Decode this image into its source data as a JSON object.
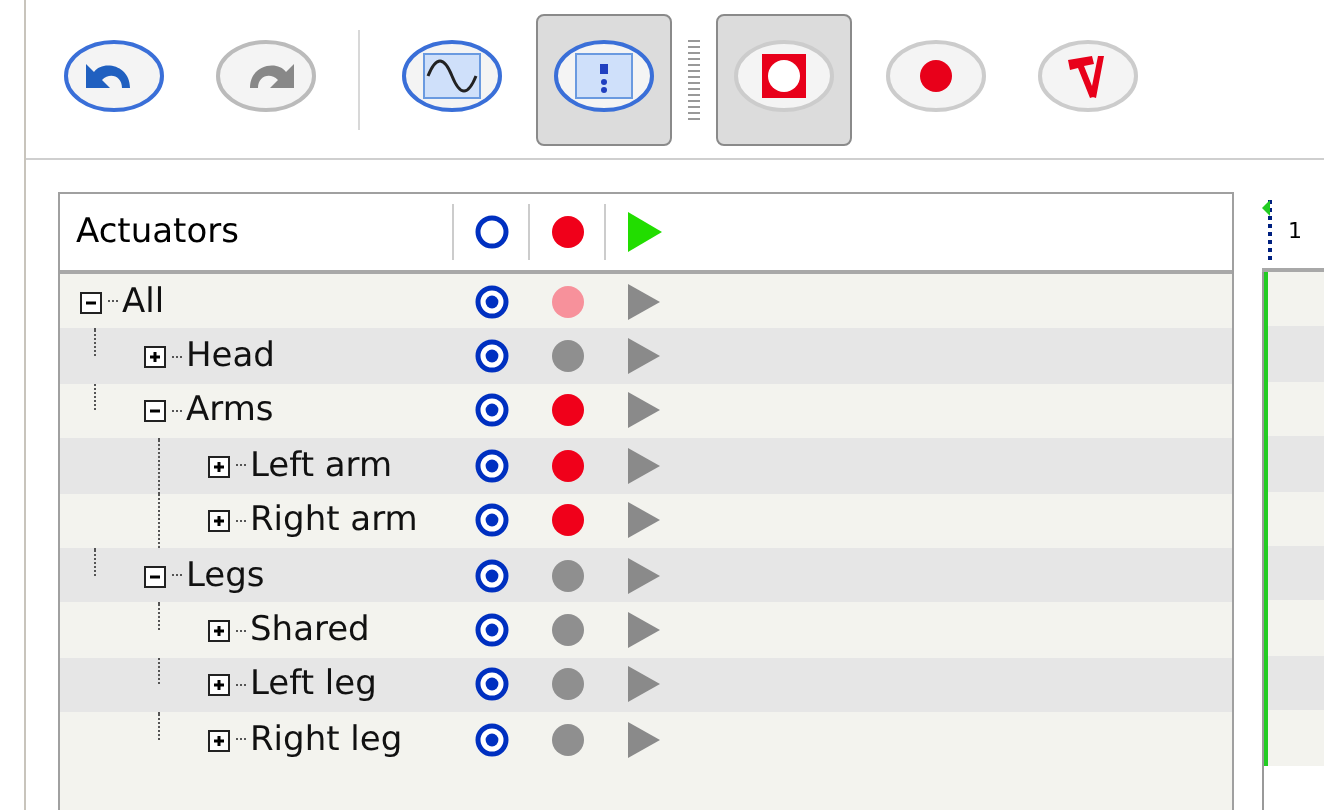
{
  "toolbar": [
    {
      "kind": "undo",
      "pressed": false,
      "disabled": false
    },
    {
      "kind": "redo",
      "pressed": false,
      "disabled": true
    },
    {
      "kind": "separator"
    },
    {
      "kind": "wave",
      "pressed": false,
      "disabled": false
    },
    {
      "kind": "script",
      "pressed": true,
      "disabled": false
    },
    {
      "kind": "grip"
    },
    {
      "kind": "stop",
      "pressed": true,
      "disabled": false
    },
    {
      "kind": "record",
      "pressed": false,
      "disabled": false
    },
    {
      "kind": "tools",
      "pressed": false,
      "disabled": false
    }
  ],
  "tree": {
    "title": "Actuators",
    "nodes": [
      {
        "label": "All",
        "expanded": true,
        "enabled": true,
        "color": "#f7919b",
        "children": [
          {
            "label": "Head",
            "expanded": false,
            "enabled": true,
            "color": "#8f8f8f"
          },
          {
            "label": "Arms",
            "expanded": true,
            "enabled": true,
            "color": "#f0001a",
            "children": [
              {
                "label": "Left arm",
                "expanded": false,
                "enabled": true,
                "color": "#f0001a"
              },
              {
                "label": "Right arm",
                "expanded": false,
                "enabled": true,
                "color": "#f0001a"
              }
            ]
          },
          {
            "label": "Legs",
            "expanded": true,
            "enabled": true,
            "color": "#8f8f8f",
            "children": [
              {
                "label": "Shared",
                "expanded": false,
                "enabled": true,
                "color": "#8f8f8f"
              },
              {
                "label": "Left leg",
                "expanded": false,
                "enabled": true,
                "color": "#8f8f8f"
              },
              {
                "label": "Right leg",
                "expanded": false,
                "enabled": true,
                "color": "#8f8f8f"
              }
            ]
          }
        ]
      }
    ]
  },
  "timeline": {
    "first_mark": "1"
  }
}
